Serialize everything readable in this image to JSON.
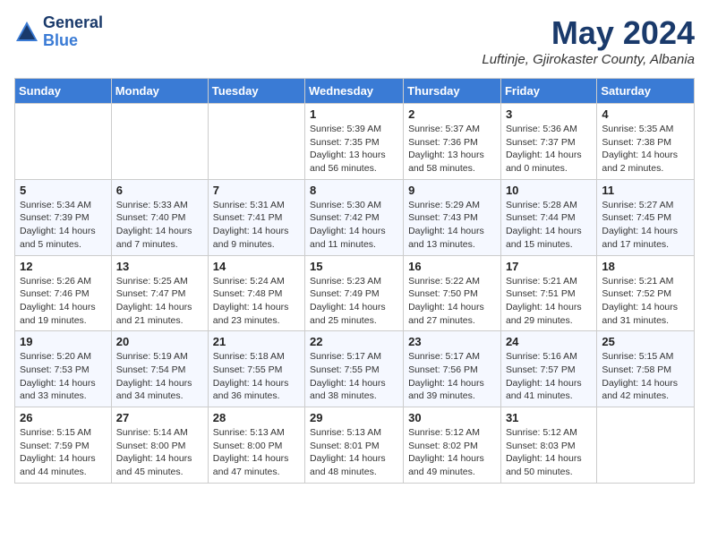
{
  "header": {
    "logo_general": "General",
    "logo_blue": "Blue",
    "month_title": "May 2024",
    "subtitle": "Luftinje, Gjirokaster County, Albania"
  },
  "days_of_week": [
    "Sunday",
    "Monday",
    "Tuesday",
    "Wednesday",
    "Thursday",
    "Friday",
    "Saturday"
  ],
  "weeks": [
    [
      {
        "day": "",
        "info": ""
      },
      {
        "day": "",
        "info": ""
      },
      {
        "day": "",
        "info": ""
      },
      {
        "day": "1",
        "info": "Sunrise: 5:39 AM\nSunset: 7:35 PM\nDaylight: 13 hours and 56 minutes."
      },
      {
        "day": "2",
        "info": "Sunrise: 5:37 AM\nSunset: 7:36 PM\nDaylight: 13 hours and 58 minutes."
      },
      {
        "day": "3",
        "info": "Sunrise: 5:36 AM\nSunset: 7:37 PM\nDaylight: 14 hours and 0 minutes."
      },
      {
        "day": "4",
        "info": "Sunrise: 5:35 AM\nSunset: 7:38 PM\nDaylight: 14 hours and 2 minutes."
      }
    ],
    [
      {
        "day": "5",
        "info": "Sunrise: 5:34 AM\nSunset: 7:39 PM\nDaylight: 14 hours and 5 minutes."
      },
      {
        "day": "6",
        "info": "Sunrise: 5:33 AM\nSunset: 7:40 PM\nDaylight: 14 hours and 7 minutes."
      },
      {
        "day": "7",
        "info": "Sunrise: 5:31 AM\nSunset: 7:41 PM\nDaylight: 14 hours and 9 minutes."
      },
      {
        "day": "8",
        "info": "Sunrise: 5:30 AM\nSunset: 7:42 PM\nDaylight: 14 hours and 11 minutes."
      },
      {
        "day": "9",
        "info": "Sunrise: 5:29 AM\nSunset: 7:43 PM\nDaylight: 14 hours and 13 minutes."
      },
      {
        "day": "10",
        "info": "Sunrise: 5:28 AM\nSunset: 7:44 PM\nDaylight: 14 hours and 15 minutes."
      },
      {
        "day": "11",
        "info": "Sunrise: 5:27 AM\nSunset: 7:45 PM\nDaylight: 14 hours and 17 minutes."
      }
    ],
    [
      {
        "day": "12",
        "info": "Sunrise: 5:26 AM\nSunset: 7:46 PM\nDaylight: 14 hours and 19 minutes."
      },
      {
        "day": "13",
        "info": "Sunrise: 5:25 AM\nSunset: 7:47 PM\nDaylight: 14 hours and 21 minutes."
      },
      {
        "day": "14",
        "info": "Sunrise: 5:24 AM\nSunset: 7:48 PM\nDaylight: 14 hours and 23 minutes."
      },
      {
        "day": "15",
        "info": "Sunrise: 5:23 AM\nSunset: 7:49 PM\nDaylight: 14 hours and 25 minutes."
      },
      {
        "day": "16",
        "info": "Sunrise: 5:22 AM\nSunset: 7:50 PM\nDaylight: 14 hours and 27 minutes."
      },
      {
        "day": "17",
        "info": "Sunrise: 5:21 AM\nSunset: 7:51 PM\nDaylight: 14 hours and 29 minutes."
      },
      {
        "day": "18",
        "info": "Sunrise: 5:21 AM\nSunset: 7:52 PM\nDaylight: 14 hours and 31 minutes."
      }
    ],
    [
      {
        "day": "19",
        "info": "Sunrise: 5:20 AM\nSunset: 7:53 PM\nDaylight: 14 hours and 33 minutes."
      },
      {
        "day": "20",
        "info": "Sunrise: 5:19 AM\nSunset: 7:54 PM\nDaylight: 14 hours and 34 minutes."
      },
      {
        "day": "21",
        "info": "Sunrise: 5:18 AM\nSunset: 7:55 PM\nDaylight: 14 hours and 36 minutes."
      },
      {
        "day": "22",
        "info": "Sunrise: 5:17 AM\nSunset: 7:55 PM\nDaylight: 14 hours and 38 minutes."
      },
      {
        "day": "23",
        "info": "Sunrise: 5:17 AM\nSunset: 7:56 PM\nDaylight: 14 hours and 39 minutes."
      },
      {
        "day": "24",
        "info": "Sunrise: 5:16 AM\nSunset: 7:57 PM\nDaylight: 14 hours and 41 minutes."
      },
      {
        "day": "25",
        "info": "Sunrise: 5:15 AM\nSunset: 7:58 PM\nDaylight: 14 hours and 42 minutes."
      }
    ],
    [
      {
        "day": "26",
        "info": "Sunrise: 5:15 AM\nSunset: 7:59 PM\nDaylight: 14 hours and 44 minutes."
      },
      {
        "day": "27",
        "info": "Sunrise: 5:14 AM\nSunset: 8:00 PM\nDaylight: 14 hours and 45 minutes."
      },
      {
        "day": "28",
        "info": "Sunrise: 5:13 AM\nSunset: 8:00 PM\nDaylight: 14 hours and 47 minutes."
      },
      {
        "day": "29",
        "info": "Sunrise: 5:13 AM\nSunset: 8:01 PM\nDaylight: 14 hours and 48 minutes."
      },
      {
        "day": "30",
        "info": "Sunrise: 5:12 AM\nSunset: 8:02 PM\nDaylight: 14 hours and 49 minutes."
      },
      {
        "day": "31",
        "info": "Sunrise: 5:12 AM\nSunset: 8:03 PM\nDaylight: 14 hours and 50 minutes."
      },
      {
        "day": "",
        "info": ""
      }
    ]
  ]
}
